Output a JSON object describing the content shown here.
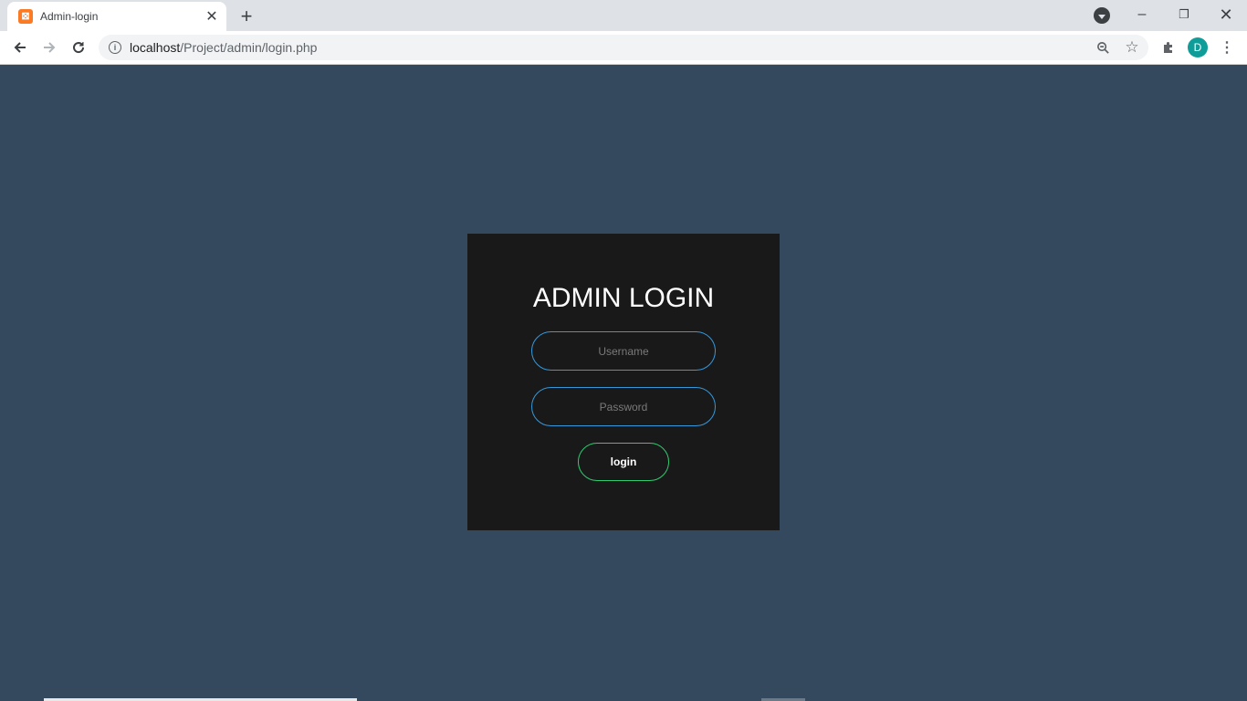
{
  "browser": {
    "tab_title": "Admin-login",
    "tab_favicon": "xampp-icon",
    "url_host": "localhost",
    "url_path": "/Project/admin/login.php",
    "profile_initial": "D",
    "colors": {
      "tabbar": "#dee1e6",
      "avatar": "#0f9d9a"
    }
  },
  "login": {
    "title": "ADMIN LOGIN",
    "username_placeholder": "Username",
    "password_placeholder": "Password",
    "submit_label": "login",
    "colors": {
      "page_background": "#34495e",
      "card_background": "#191919",
      "input_border": "#3498db",
      "button_border": "#2ecc71"
    }
  }
}
